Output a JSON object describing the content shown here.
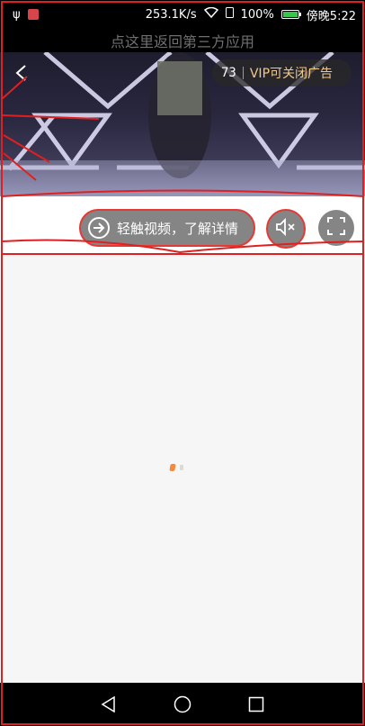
{
  "status_bar": {
    "network_speed": "253.1K/s",
    "battery_percent": "100%",
    "time": "傍晚5:22"
  },
  "return_banner": {
    "text": "点这里返回第三方应用"
  },
  "ad": {
    "countdown": "73",
    "vip_close_label": "VIP可关闭广告"
  },
  "video_controls": {
    "learn_more_label": "轻触视频，了解详情"
  },
  "colors": {
    "accent_orange": "#f38b3d",
    "vip_gold": "#f3c98b",
    "annotation_red": "#e02020"
  }
}
